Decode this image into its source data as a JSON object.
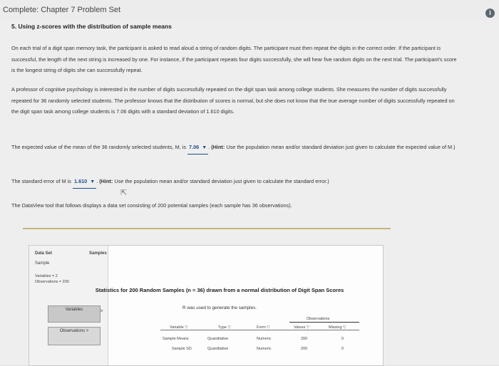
{
  "header": {
    "title": "Complete: Chapter 7 Problem Set",
    "info_glyph": "i"
  },
  "section": {
    "heading": "5. Using z-scores with the distribution of sample means"
  },
  "paragraphs": {
    "p1": "On each trial of a digit span memory task, the participant is asked to read aloud a string of random digits. The participant must then repeat the digits in the correct order. If the participant is successful, the length of the next string is increased by one. For instance, if the participant repeats four digits successfully, she will hear five random digits on the next trial. The participant's score is the longest string of digits she can successfully repeat.",
    "p2": "A professor of cognitive psychology is interested in the number of digits successfully repeated on the digit span task among college students. She measures the number of digits successfully repeated for 36 randomly selected students. The professor knows that the distribution of scores is normal, but she does not know that the true average number of digits successfully repeated on the digit span task among college students is 7.06 digits with a standard deviation of 1.610 digits.",
    "q1_text": "The expected value of the mean of the 36 randomly selected students, M, is",
    "q1_value": "7.06",
    "q1_hint_label": "(Hint:",
    "q1_hint_text": "Use the population mean and/or standard deviation just given to calculate the expected value of M.)",
    "q2_text": "The standard error of M is",
    "q2_value": "1.610",
    "q2_hint_label": "(Hint:",
    "q2_hint_text": "Use the population mean and/or standard deviation just given to calculate the standard error.)",
    "p3": "The DataView tool that follows displays a data set consisting of 200 potential samples (each sample has 36 observations)."
  },
  "dataview": {
    "data_set_label": "Data Set",
    "samples_label": "Samples",
    "sample_name": "Sample",
    "variables_meta": "Variables = 2",
    "observations_meta": "Observations = 200",
    "variables_button": "Variables",
    "observations_button": "Observations",
    "chevron": ">",
    "stats_title": "Statistics for 200 Random Samples (n = 36) drawn from a normal distribution of Digit Span Scores",
    "stats_subtitle": "R was used to generate the samples.",
    "observations_header": "Observations",
    "columns": {
      "variable": "Variable ▽",
      "type": "Type ▽",
      "form": "Form ▽",
      "values": "Values ▽",
      "missing": "Missing ▽"
    },
    "rows": [
      {
        "variable": "Sample Means",
        "type": "Quantitative",
        "form": "Numeric",
        "values": "200",
        "missing": "0"
      },
      {
        "variable": "Sample SD",
        "type": "Quantitative",
        "form": "Numeric",
        "values": "200",
        "missing": "0"
      }
    ]
  }
}
